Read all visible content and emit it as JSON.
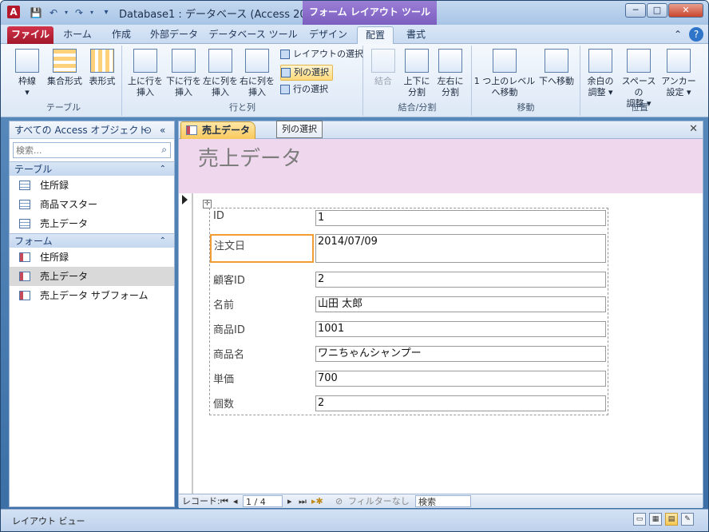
{
  "title": "Database1 : データベース (Access 200...",
  "context_tab_title": "フォーム レイアウト ツール",
  "window_controls": {
    "minimize": "─",
    "maximize": "□",
    "close": "✕"
  },
  "tabs": [
    {
      "label": "ファイル"
    },
    {
      "label": "ホーム"
    },
    {
      "label": "作成"
    },
    {
      "label": "外部データ"
    },
    {
      "label": "データベース ツール"
    },
    {
      "label": "デザイン"
    },
    {
      "label": "配置"
    },
    {
      "label": "書式"
    }
  ],
  "ribbon": {
    "groups": {
      "table": "テーブル",
      "rows_cols": "行と列",
      "merge_split": "結合/分割",
      "move": "移動",
      "position": "位置"
    },
    "table_buttons": [
      {
        "label": "枠線"
      },
      {
        "label": "集合形式"
      },
      {
        "label": "表形式"
      }
    ],
    "insert_buttons": [
      {
        "line1": "上に行を",
        "line2": "挿入"
      },
      {
        "line1": "下に行を",
        "line2": "挿入"
      },
      {
        "line1": "左に列を",
        "line2": "挿入"
      },
      {
        "line1": "右に列を",
        "line2": "挿入"
      }
    ],
    "select_buttons": [
      {
        "label": "レイアウトの選択"
      },
      {
        "label": "列の選択"
      },
      {
        "label": "行の選択"
      }
    ],
    "merge_buttons": [
      {
        "line1": "結合",
        "line2": ""
      },
      {
        "line1": "上下に",
        "line2": "分割"
      },
      {
        "line1": "左右に",
        "line2": "分割"
      }
    ],
    "move_buttons": [
      {
        "line1": "1 つ上のレベル",
        "line2": "へ移動"
      },
      {
        "line1": "下へ移動",
        "line2": ""
      }
    ],
    "position_buttons": [
      {
        "line1": "余白の",
        "line2": "調整 ▾"
      },
      {
        "line1": "スペースの",
        "line2": "調整 ▾"
      },
      {
        "line1": "アンカー",
        "line2": "設定 ▾"
      }
    ]
  },
  "tooltip": "列の選択",
  "nav": {
    "header": "すべての Access オブジェクト",
    "search_placeholder": "検索...",
    "sections": [
      {
        "title": "テーブル",
        "items": [
          "住所録",
          "商品マスター",
          "売上データ"
        ]
      },
      {
        "title": "フォーム",
        "items": [
          "住所録",
          "売上データ",
          "売上データ サブフォーム"
        ]
      }
    ]
  },
  "doc": {
    "tab_label": "売上データ",
    "form_title": "売上データ",
    "fields": [
      {
        "label": "ID",
        "value": "1"
      },
      {
        "label": "注文日",
        "value": "2014/07/09"
      },
      {
        "label": "顧客ID",
        "value": "2"
      },
      {
        "label": "名前",
        "value": "山田 太郎"
      },
      {
        "label": "商品ID",
        "value": "1001"
      },
      {
        "label": "商品名",
        "value": "ワニちゃんシャンプー"
      },
      {
        "label": "単価",
        "value": "700"
      },
      {
        "label": "個数",
        "value": "2"
      }
    ]
  },
  "record_nav": {
    "label": "レコード:",
    "position": "1 / 4",
    "filter": "フィルターなし",
    "search": "検索"
  },
  "status": {
    "text": "レイアウト ビュー"
  },
  "colors": {
    "accent": "#7b5dbf",
    "file_tab": "#b3192a",
    "selection": "#f39c32",
    "form_header": "#efd7ed"
  }
}
